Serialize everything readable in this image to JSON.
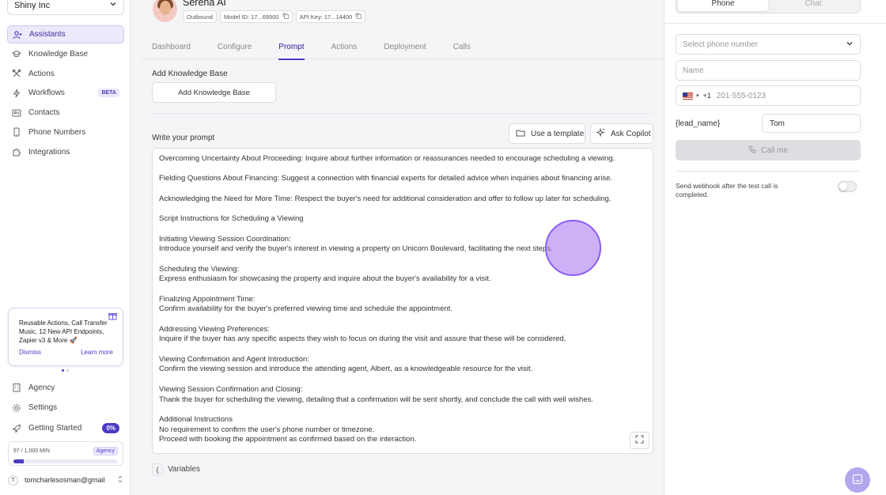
{
  "sidebar": {
    "org": "Shiny Inc",
    "items": [
      {
        "label": "Assistants"
      },
      {
        "label": "Knowledge Base"
      },
      {
        "label": "Actions"
      },
      {
        "label": "Workflows",
        "badge": "BETA"
      },
      {
        "label": "Contacts"
      },
      {
        "label": "Phone Numbers"
      },
      {
        "label": "Integrations"
      }
    ],
    "promo": {
      "text": "Reusable Actions, Call Transfer Music, 12 New API Endpoints, Zapier v3 & More 🚀",
      "dismiss": "Dismiss",
      "learn_more": "Learn more"
    },
    "bottom_items": [
      {
        "label": "Agency"
      },
      {
        "label": "Settings"
      },
      {
        "label": "Getting Started",
        "badge": "0%"
      }
    ],
    "usage": {
      "text": "97 / 1,000 MIN",
      "badge": "Agency",
      "fraction": 0.097
    },
    "user_email": "tomcharlesosman@gmail"
  },
  "header": {
    "title": "Serena AI",
    "chips": {
      "direction": "Outbound",
      "model_id": "Model ID: 17...69500",
      "api_key": "API Key: 17...14400"
    }
  },
  "tabs": [
    "Dashboard",
    "Configure",
    "Prompt",
    "Actions",
    "Deployment",
    "Calls"
  ],
  "active_tab": "Prompt",
  "knowledge_base": {
    "label": "Add Knowledge Base",
    "button": "Add Knowledge Base"
  },
  "prompt": {
    "label": "Write your prompt",
    "template_button": "Use a template",
    "copilot_button": "Ask Copilot",
    "lines": [
      "Overcoming Uncertainty About Proceeding: Inquire about further information or reassurances needed to encourage scheduling a viewing.",
      "",
      "Fielding Questions About Financing: Suggest a connection with financial experts for detailed advice when inquiries about financing arise.",
      "",
      "Acknowledging the Need for More Time: Respect the buyer's need for additional consideration and offer to follow up later for scheduling.",
      "",
      "Script Instructions for Scheduling a Viewing",
      "",
      "Initiating Viewing Session Coordination:",
      "Introduce yourself and verify the buyer's interest in viewing a property on Unicorn Boulevard, facilitating the next steps.",
      "",
      "Scheduling the Viewing:",
      "Express enthusiasm for showcasing the property and inquire about the buyer's availability for a visit.",
      "",
      "Finalizing Appointment Time:",
      "Confirm availability for the buyer's preferred viewing time and schedule the appointment.",
      "",
      "Addressing Viewing Preferences:",
      "Inquire if the buyer has any specific aspects they wish to focus on during the visit and assure that these will be considered.",
      "",
      "Viewing Confirmation and Agent Introduction:",
      "Confirm the viewing session and introduce the attending agent, Albert, as a knowledgeable resource for the visit.",
      "",
      "Viewing Session Confirmation and Closing:",
      "Thank the buyer for scheduling the viewing, detailing that a confirmation will be sent shortly, and conclude the call with well wishes.",
      "",
      "Additional Instructions",
      "No requirement to confirm the user's phone number or timezone.",
      "Proceed with booking the appointment as confirmed based on the interaction."
    ],
    "variables_label": "Variables"
  },
  "test_panel": {
    "modes": [
      "Phone",
      "Chat"
    ],
    "active_mode": "Phone",
    "phone_select_placeholder": "Select phone number",
    "name_placeholder": "Name",
    "country_code": "+1",
    "phone_placeholder": "201-555-0123",
    "lead_label": "{lead_name}",
    "lead_value": "Tom",
    "call_button": "Call me",
    "webhook_text": "Send webhook after the test call is completed.",
    "webhook_enabled": false
  },
  "colors": {
    "accent": "#4c3bc4",
    "accent_light": "#ece9fb"
  }
}
